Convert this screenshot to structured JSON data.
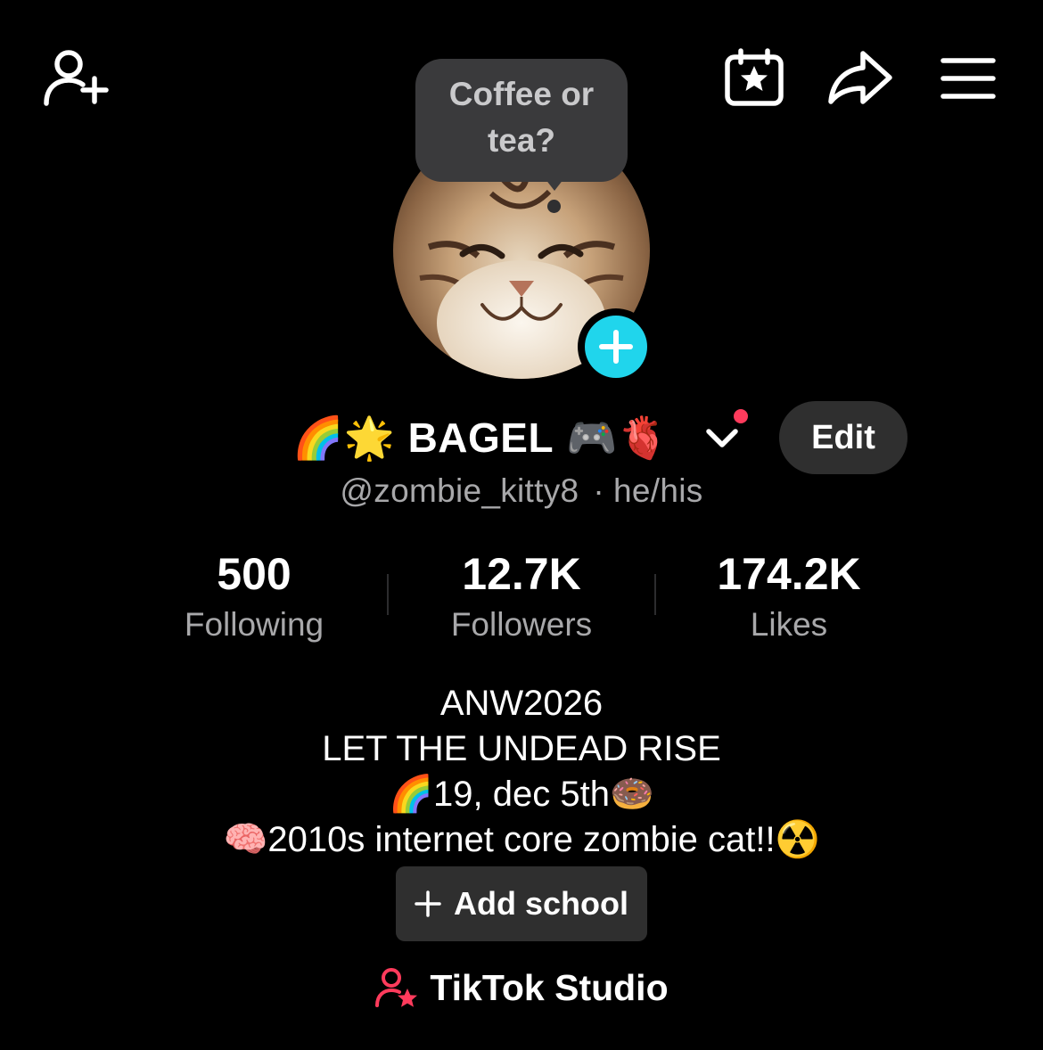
{
  "header": {
    "add_friend_icon": "person-plus-icon",
    "calendar_icon": "calendar-star-icon",
    "share_icon": "share-arrow-icon",
    "menu_icon": "hamburger-menu-icon"
  },
  "note_bubble": {
    "line1": "Coffee or",
    "line2": "tea?"
  },
  "profile": {
    "avatar_alt": "smiling kitten",
    "add_button_icon": "plus-icon",
    "name_prefix_emoji": "🌈🌟",
    "name": "BAGEL",
    "name_suffix_emoji": "🎮🫀",
    "edit_label": "Edit",
    "handle": "@zombie_kitty8",
    "separator": "·",
    "pronouns": "he/his",
    "accent_color": "#20d5ec",
    "notification_color": "#ff3b5c"
  },
  "stats": [
    {
      "value": "500",
      "label": "Following"
    },
    {
      "value": "12.7K",
      "label": "Followers"
    },
    {
      "value": "174.2K",
      "label": "Likes"
    }
  ],
  "bio": {
    "line1": "ANW2026",
    "line2": "LET THE UNDEAD RISE",
    "line3_emoji_start": "🌈",
    "line3_text": "19, dec 5th",
    "line3_emoji_end": "🍩",
    "line4_emoji_start": "🧠",
    "line4_text": "2010s internet core zombie cat!!",
    "line4_emoji_end": "☢️"
  },
  "add_school": {
    "label": "Add school"
  },
  "studio": {
    "label": "TikTok Studio",
    "icon": "creator-person-star-icon"
  }
}
